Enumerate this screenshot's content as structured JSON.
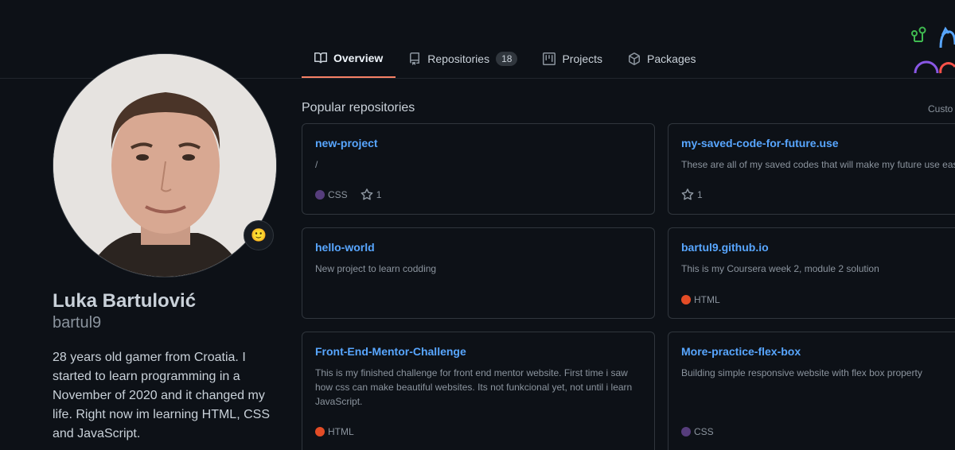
{
  "tabs": [
    {
      "label": "Overview",
      "icon": "book-icon",
      "active": true
    },
    {
      "label": "Repositories",
      "icon": "repo-icon",
      "count": "18"
    },
    {
      "label": "Projects",
      "icon": "project-icon"
    },
    {
      "label": "Packages",
      "icon": "package-icon"
    }
  ],
  "profile": {
    "fullname": "Luka Bartulović",
    "login": "bartul9",
    "bio": "28 years old gamer from Croatia. I started to learn programming in a November of 2020 and it changed my life. Right now im learning HTML, CSS and JavaScript.",
    "status_emoji": "🙂"
  },
  "popular": {
    "title": "Popular repositories",
    "customize_label": "Custo"
  },
  "repos": [
    {
      "name": "new-project",
      "description": "/",
      "language": "CSS",
      "lang_color": "#563d7c",
      "stars": "1"
    },
    {
      "name": "my-saved-code-for-future.use",
      "description": "These are all of my saved codes that will make my future use easi",
      "language": "",
      "lang_color": "",
      "stars": "1"
    },
    {
      "name": "hello-world",
      "description": "New project to learn codding",
      "language": "",
      "lang_color": "",
      "stars": ""
    },
    {
      "name": "bartul9.github.io",
      "description": "This is my Coursera week 2, module 2 solution",
      "language": "HTML",
      "lang_color": "#e34c26",
      "stars": ""
    },
    {
      "name": "Front-End-Mentor-Challenge",
      "description": "This is my finished challenge for front end mentor website. First time i saw how css can make beautiful websites. Its not funkcional yet, not until i learn JavaScript.",
      "language": "HTML",
      "lang_color": "#e34c26",
      "stars": ""
    },
    {
      "name": "More-practice-flex-box",
      "description": "Building simple responsive website with flex box property",
      "language": "CSS",
      "lang_color": "#563d7c",
      "stars": ""
    }
  ],
  "colors": {
    "background": "#0d1117",
    "link": "#58a6ff",
    "active_tab_underline": "#f78166",
    "border": "#30363d"
  }
}
